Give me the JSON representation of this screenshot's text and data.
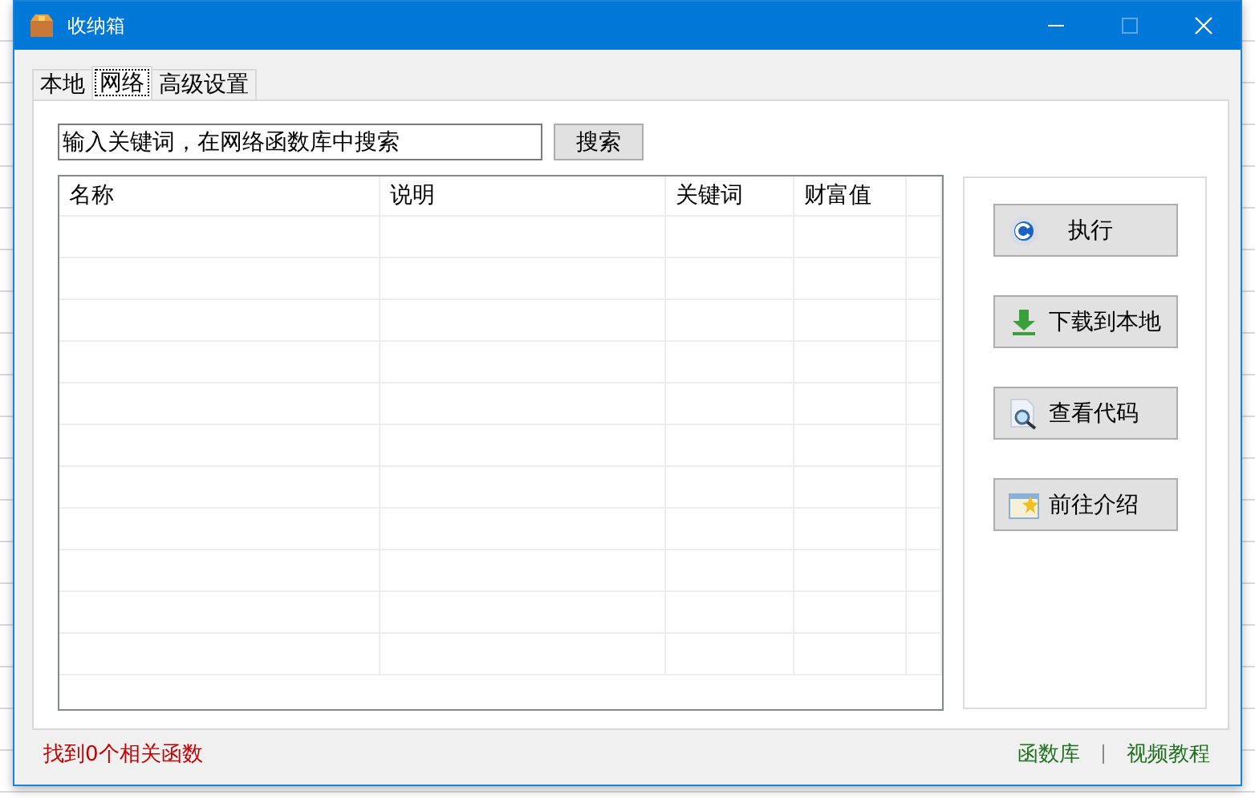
{
  "window": {
    "title": "收纳箱"
  },
  "tabs": [
    {
      "label": "本地",
      "selected": false
    },
    {
      "label": "网络",
      "selected": true
    },
    {
      "label": "高级设置",
      "selected": false
    }
  ],
  "search": {
    "value": "输入关键词，在网络函数库中搜索",
    "button": "搜索"
  },
  "table": {
    "columns": [
      "名称",
      "说明",
      "关键词",
      "财富值"
    ]
  },
  "actions": [
    {
      "label": "执行",
      "kind": "run"
    },
    {
      "label": "下载到本地",
      "kind": "download"
    },
    {
      "label": "查看代码",
      "kind": "view"
    },
    {
      "label": "前往介绍",
      "kind": "intro"
    }
  ],
  "status": "找到0个相关函数",
  "links": [
    "函数库",
    "视频教程"
  ]
}
